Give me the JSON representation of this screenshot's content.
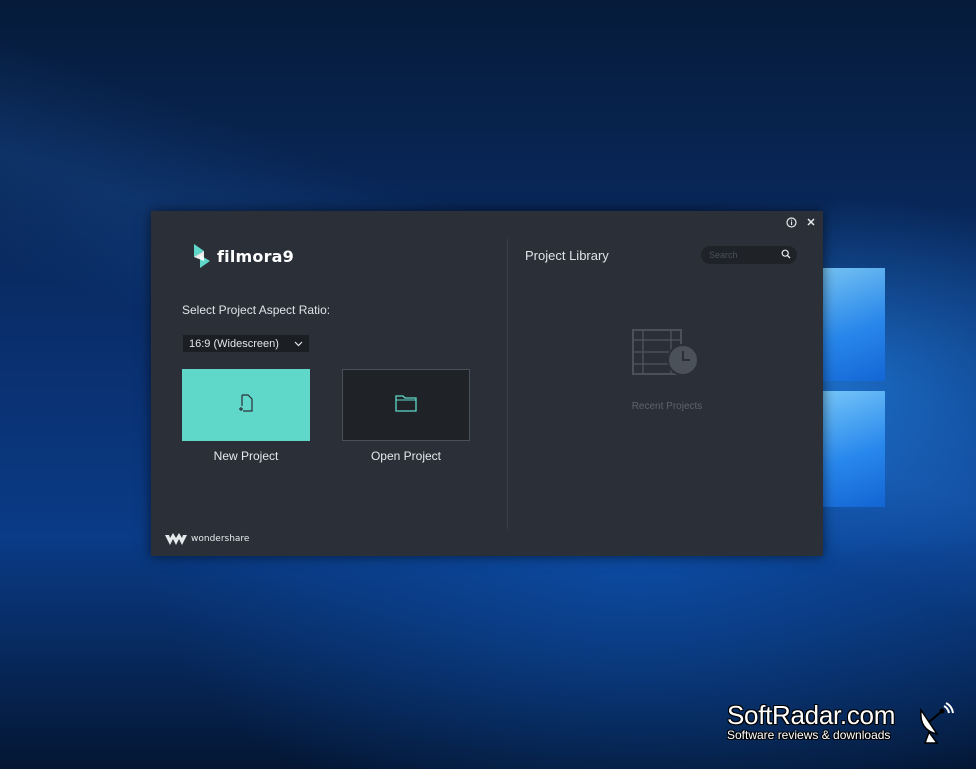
{
  "app": {
    "logo_text": "filmora9",
    "aspect_ratio_label": "Select Project Aspect Ratio:",
    "aspect_ratio_selected": "16:9 (Widescreen)",
    "new_project_label": "New Project",
    "open_project_label": "Open Project",
    "brand_text": "wondershare",
    "accent_color": "#5fd8c9",
    "library": {
      "title": "Project Library",
      "search_placeholder": "Search",
      "empty_label": "Recent Projects"
    }
  },
  "icons": {
    "info": "info-icon",
    "close": "close-icon",
    "search": "search-icon",
    "new_file": "new-file-icon",
    "folder": "folder-icon",
    "recent": "film-clock-icon"
  },
  "watermark": {
    "main": "SoftRadar.com",
    "sub": "Software reviews & downloads"
  }
}
